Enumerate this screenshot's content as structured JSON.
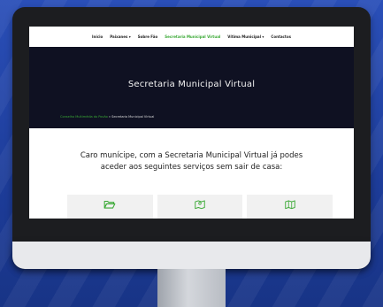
{
  "nav": {
    "items": [
      {
        "label": "Início",
        "active": false
      },
      {
        "label": "Paixanes ▾",
        "active": false
      },
      {
        "label": "Sobre Fão",
        "active": false
      },
      {
        "label": "Secretaria Municipal Virtual",
        "active": true
      },
      {
        "label": "Vítima Municipal ▾",
        "active": false
      },
      {
        "label": "Contactos",
        "active": false
      }
    ],
    "active_color": "#3aa935"
  },
  "hero": {
    "title": "Secretaria Municipal Virtual",
    "background": "#0f1122"
  },
  "breadcrumb": {
    "home": "Conselho Multimédia do Povão",
    "separator": " » ",
    "current": "Secretaria Municipal Virtual"
  },
  "intro": {
    "line1": "Caro munícipe, com a Secretaria Municipal Virtual já podes",
    "line2": "aceder aos seguintes serviços sem sair de casa:"
  },
  "cards": [
    {
      "icon": "folder-open-icon"
    },
    {
      "icon": "map-pin-icon"
    },
    {
      "icon": "map-icon"
    }
  ]
}
